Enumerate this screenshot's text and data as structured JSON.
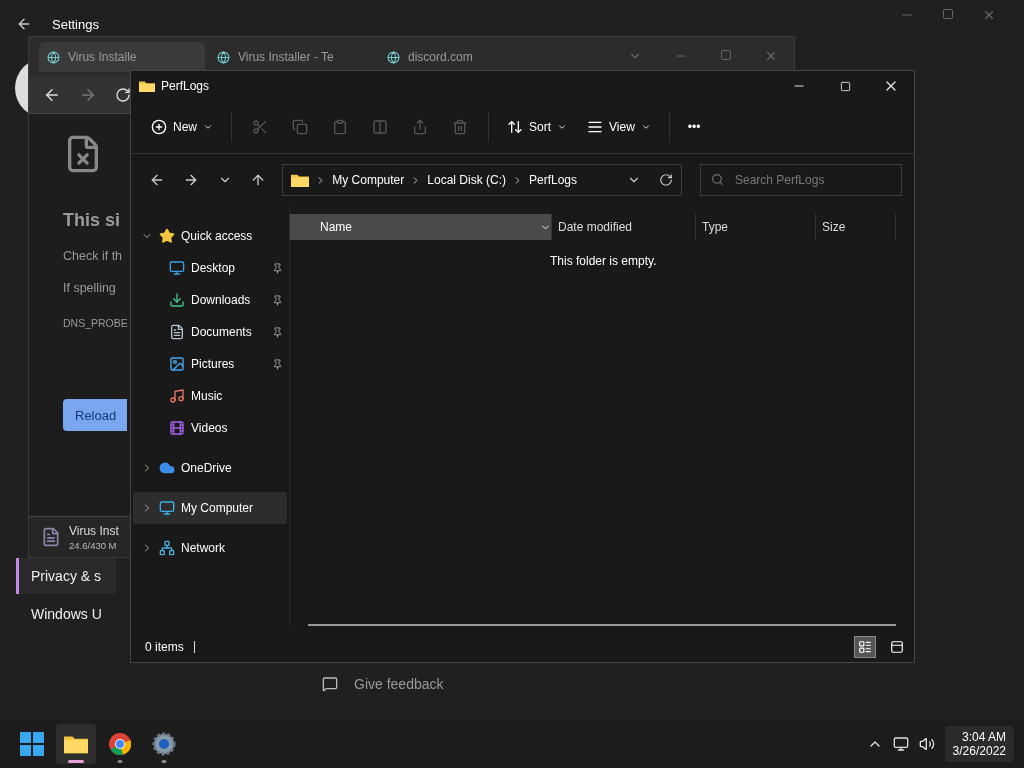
{
  "settings": {
    "title": "Settings",
    "nav": [
      {
        "label": "Privacy & s",
        "selected": true
      },
      {
        "label": "Windows U",
        "selected": false
      }
    ],
    "feedback": "Give feedback"
  },
  "browser": {
    "tabs": [
      {
        "label": "Virus Installe",
        "selected": true
      },
      {
        "label": "Virus Installer - Te",
        "selected": false
      },
      {
        "label": "discord.com",
        "selected": false
      }
    ],
    "page": {
      "heading": "This si",
      "lines": [
        "Check if th",
        "If spelling"
      ],
      "code": "DNS_PROBE",
      "button": "Reload"
    },
    "download": {
      "name": "Virus Inst",
      "progress": "24.6/430 M"
    }
  },
  "explorer": {
    "title": "PerfLogs",
    "toolbar": [
      {
        "kind": "menu",
        "label": "New",
        "disabled": false
      },
      {
        "kind": "icon",
        "disabled": true
      },
      {
        "kind": "icon",
        "disabled": true
      },
      {
        "kind": "icon",
        "disabled": true
      },
      {
        "kind": "icon",
        "disabled": true
      },
      {
        "kind": "icon",
        "disabled": true
      },
      {
        "kind": "icon",
        "disabled": true
      },
      {
        "kind": "menu",
        "label": "Sort",
        "disabled": false
      },
      {
        "kind": "menu",
        "label": "View",
        "disabled": false
      },
      {
        "kind": "more",
        "label": "•••",
        "disabled": false
      }
    ],
    "breadcrumbs": [
      "My Computer",
      "Local Disk (C:)",
      "PerfLogs"
    ],
    "search": {
      "placeholder": "Search PerfLogs"
    },
    "sidebar": [
      {
        "label": "Quick access",
        "expanded": true,
        "selected": false,
        "children": [
          {
            "label": "Desktop",
            "pinned": true
          },
          {
            "label": "Downloads",
            "pinned": true
          },
          {
            "label": "Documents",
            "pinned": true
          },
          {
            "label": "Pictures",
            "pinned": true
          },
          {
            "label": "Music",
            "pinned": false
          },
          {
            "label": "Videos",
            "pinned": false
          }
        ]
      },
      {
        "label": "OneDrive",
        "expanded": false,
        "selected": false
      },
      {
        "label": "My Computer",
        "expanded": false,
        "selected": true
      },
      {
        "label": "Network",
        "expanded": false,
        "selected": false
      }
    ],
    "columns": [
      {
        "label": "Name",
        "selected": true
      },
      {
        "label": "Date modified",
        "selected": false
      },
      {
        "label": "Type",
        "selected": false
      },
      {
        "label": "Size",
        "selected": false
      }
    ],
    "empty_message": "This folder is empty.",
    "status": "0 items",
    "views": [
      {
        "selected": true
      },
      {
        "selected": false
      }
    ]
  },
  "taskbar": {
    "apps": [
      {
        "active": true,
        "running": true
      },
      {
        "active": false,
        "running": true
      },
      {
        "active": false,
        "running": true
      }
    ],
    "time": "3:04 AM",
    "date": "3/26/2022"
  }
}
